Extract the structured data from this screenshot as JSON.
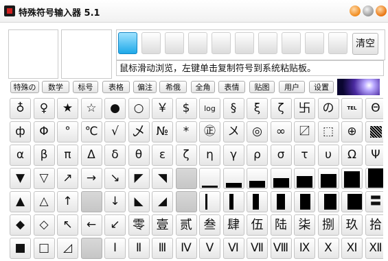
{
  "window": {
    "title": "特殊符号输入器 5.1"
  },
  "toolbar": {
    "clear_label": "清空"
  },
  "hint": "鼠标滑动浏览，左键单击复制符号到系统粘贴板。",
  "tabs": [
    "特殊の",
    "数学",
    "标号",
    "表格",
    "偏注",
    "希俄",
    "全角",
    "表情",
    "贴图",
    "用户",
    "设置"
  ],
  "symbols": [
    [
      "♁",
      "♀",
      "★",
      "☆",
      "●",
      "○",
      "￥",
      "$",
      "log",
      "§",
      "ξ",
      "ζ",
      "卐",
      "の",
      "TEL",
      "Θ"
    ],
    [
      "ф",
      "Φ",
      "°",
      "℃",
      "√",
      "乄",
      "№",
      "*",
      "㊣",
      "〤",
      "◎",
      "∞",
      "〼",
      "⬚",
      "⊕",
      "▩"
    ],
    [
      "α",
      "β",
      "π",
      "Δ",
      "δ",
      "θ",
      "ε",
      "ζ",
      "η",
      "γ",
      "ρ",
      "σ",
      "τ",
      "υ",
      "Ω",
      "Ψ"
    ],
    [
      "▼",
      "▽",
      "↗",
      "→",
      "↘",
      "◤",
      "◥",
      "",
      "▁",
      "▂",
      "▃",
      "▄",
      "▅",
      "▆",
      "▇",
      "█"
    ],
    [
      "▲",
      "△",
      "↑",
      "",
      "↓",
      "◣",
      "◢",
      "",
      "▏",
      "▎",
      "▍",
      "▌",
      "▋",
      "▊",
      "▉",
      "〓"
    ],
    [
      "◆",
      "◇",
      "↖",
      "←",
      "↙",
      "零",
      "壹",
      "贰",
      "叁",
      "肆",
      "伍",
      "陆",
      "柒",
      "捌",
      "玖",
      "拾"
    ],
    [
      "■",
      "□",
      "◿",
      "",
      "Ⅰ",
      "Ⅱ",
      "Ⅲ",
      "Ⅳ",
      "Ⅴ",
      "Ⅵ",
      "Ⅶ",
      "Ⅷ",
      "Ⅸ",
      "Ⅹ",
      "Ⅺ",
      "Ⅻ"
    ]
  ]
}
